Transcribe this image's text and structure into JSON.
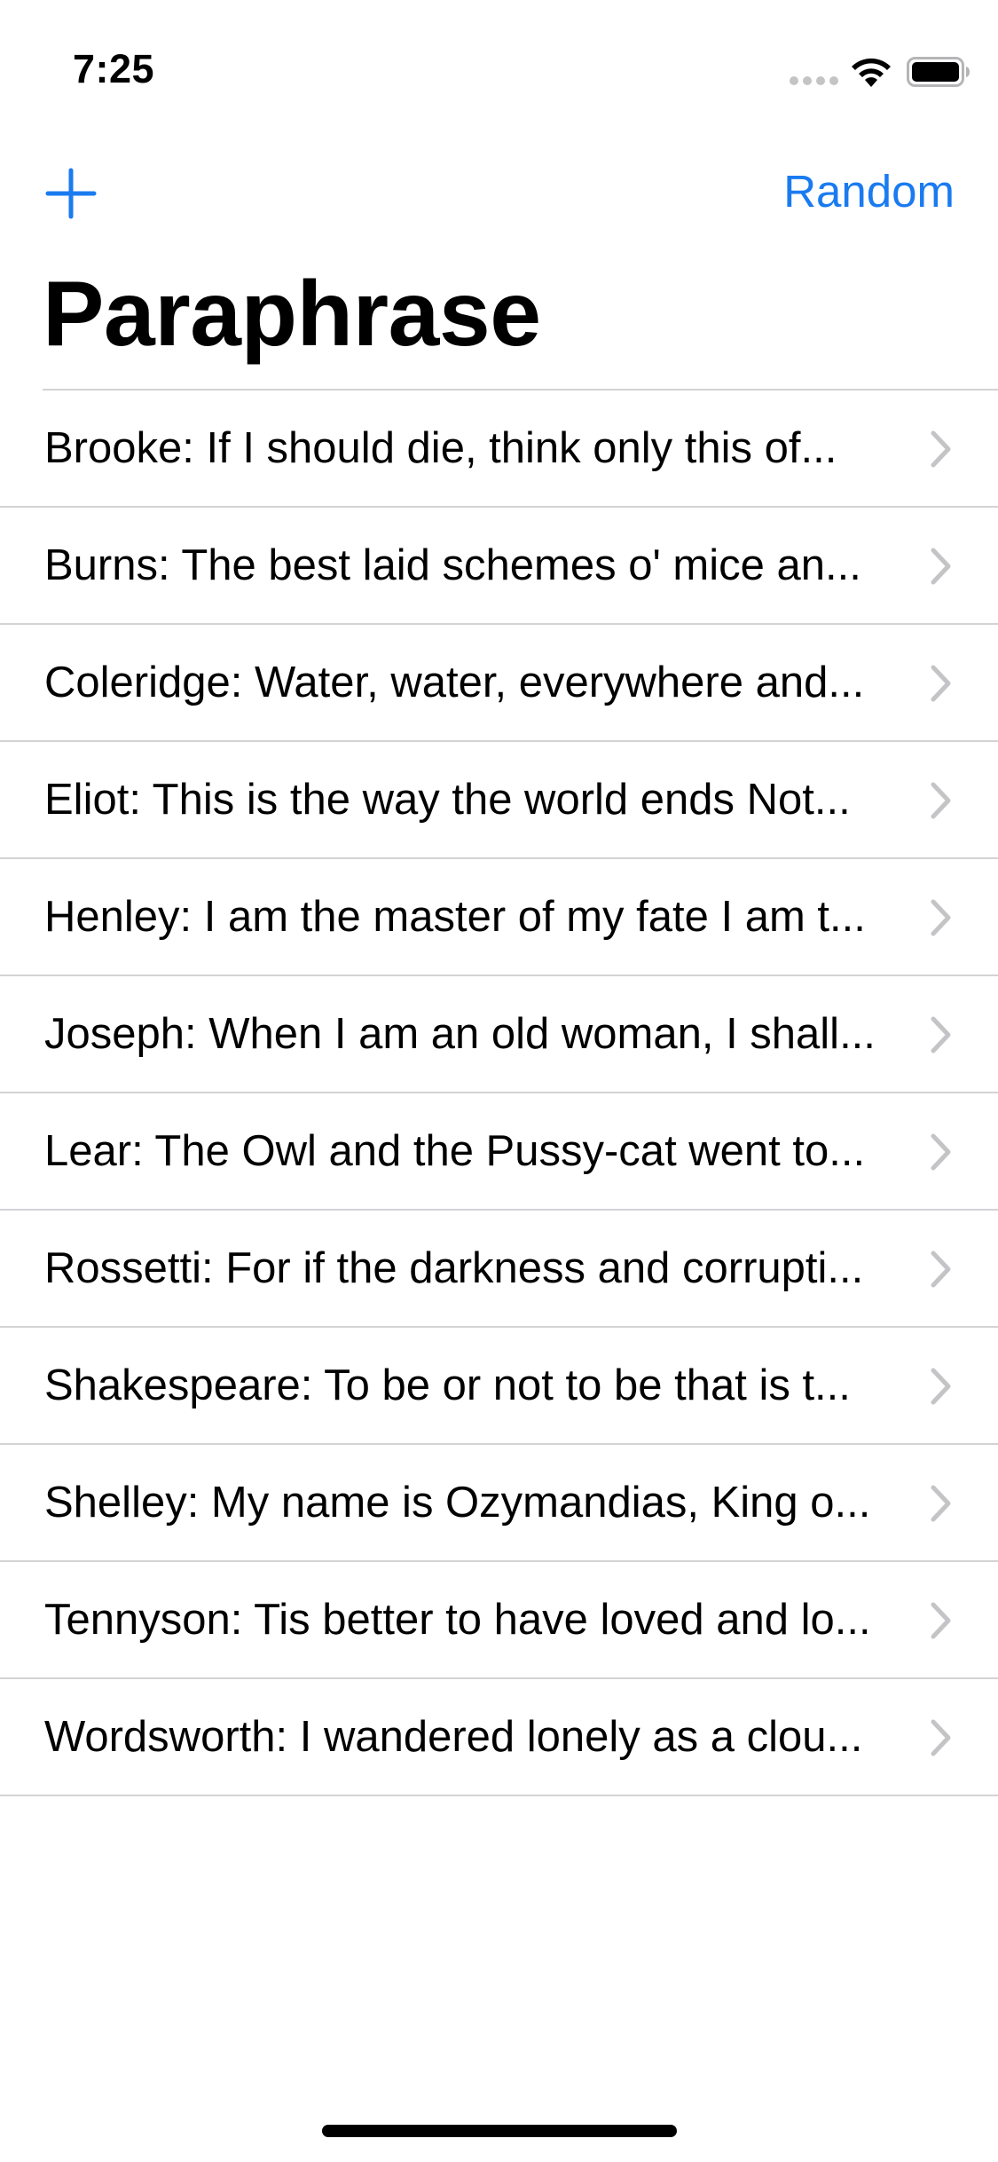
{
  "status_bar": {
    "time": "7:25",
    "icons": [
      "signal-icon",
      "wifi-icon",
      "battery-icon"
    ]
  },
  "nav": {
    "add_icon": "plus-icon",
    "random_label": "Random"
  },
  "title": "Paraphrase",
  "accent_color": "#1a7bf0",
  "list": {
    "items": [
      {
        "label": "Brooke: If I should die, think only this of..."
      },
      {
        "label": "Burns: The best laid schemes o' mice an..."
      },
      {
        "label": "Coleridge: Water, water, everywhere and..."
      },
      {
        "label": "Eliot: This is the way the world ends Not..."
      },
      {
        "label": "Henley: I am the master of my fate I am t..."
      },
      {
        "label": "Joseph: When I am an old woman, I shall..."
      },
      {
        "label": "Lear: The Owl and the Pussy-cat went to..."
      },
      {
        "label": "Rossetti: For if the darkness and corrupti..."
      },
      {
        "label": "Shakespeare: To be or not to be that is t..."
      },
      {
        "label": "Shelley: My name is Ozymandias, King o..."
      },
      {
        "label": "Tennyson: Tis better to have loved and lo..."
      },
      {
        "label": "Wordsworth: I wandered lonely as a clou..."
      }
    ],
    "row_icon": "chevron-right-icon"
  }
}
